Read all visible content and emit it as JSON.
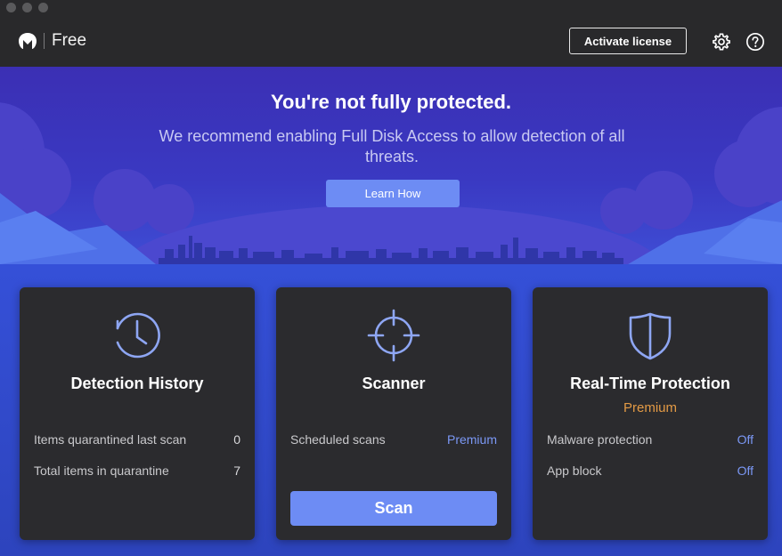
{
  "app": {
    "brand_name": "Free"
  },
  "header": {
    "activate_label": "Activate license"
  },
  "banner": {
    "title": "You're not fully protected.",
    "message": "We recommend enabling Full Disk Access to allow detection of all threats.",
    "button_label": "Learn How"
  },
  "cards": {
    "history": {
      "title": "Detection History",
      "rows": [
        {
          "label": "Items quarantined last scan",
          "value": "0"
        },
        {
          "label": "Total items in quarantine",
          "value": "7"
        }
      ]
    },
    "scanner": {
      "title": "Scanner",
      "rows": [
        {
          "label": "Scheduled scans",
          "value": "Premium"
        }
      ],
      "button_label": "Scan"
    },
    "rtp": {
      "title": "Real-Time Protection",
      "subtitle": "Premium",
      "rows": [
        {
          "label": "Malware protection",
          "value": "Off"
        },
        {
          "label": "App block",
          "value": "Off"
        }
      ]
    }
  },
  "icons": {
    "logo": "malwarebytes-logo-icon",
    "settings": "gear-icon",
    "help": "help-icon",
    "history": "clock-history-icon",
    "scanner": "crosshair-icon",
    "rtp": "shield-icon"
  },
  "colors": {
    "accent": "#6d8cf4",
    "premium": "#e39a45",
    "link": "#7b98f5",
    "banner": "#3a39c2",
    "card": "#2b2b2e"
  }
}
